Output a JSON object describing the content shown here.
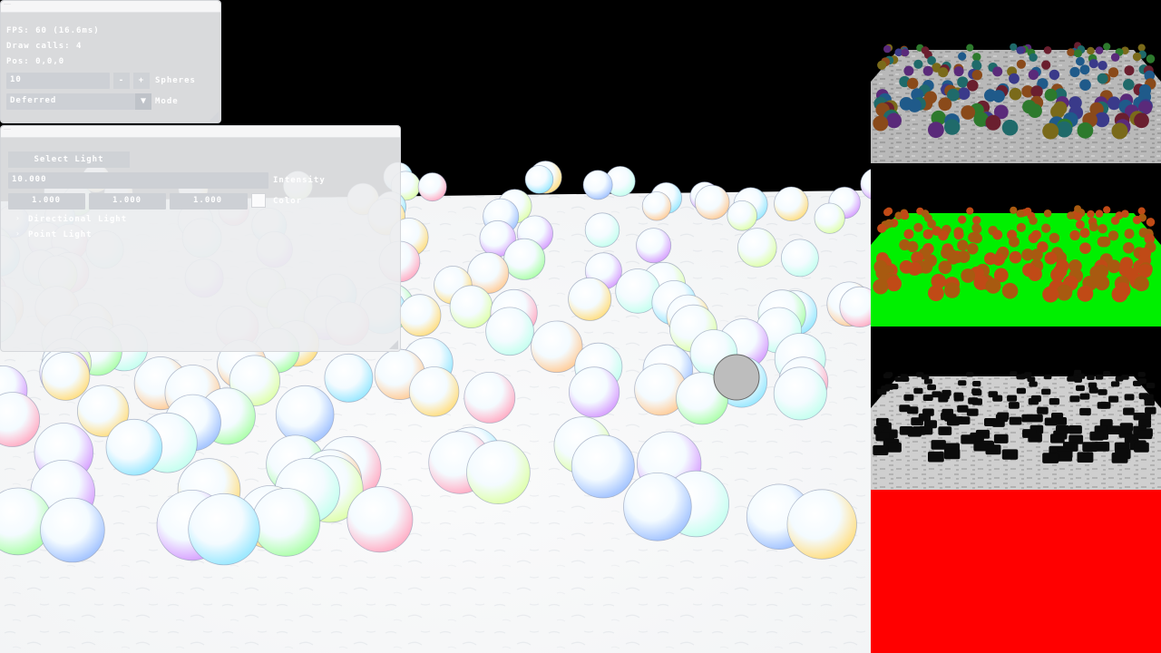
{
  "stats_panel": {
    "line1": "FPS: 60 (16.6ms)",
    "line2": "Draw calls: 4",
    "line3": "Pos: 0,0,0",
    "spin_value": "10",
    "minus_label": "-",
    "plus_label": "+",
    "spin_label": "Spheres",
    "combo_value": "Deferred",
    "combo_arrow": "▼",
    "combo_label": "Mode"
  },
  "light_panel": {
    "header_button": "Select Light",
    "intensity_value": "10.000",
    "intensity_label": "Intensity",
    "color_r": "1.000",
    "color_g": "1.000",
    "color_b": "1.000",
    "color_label": "Color",
    "tree_items": [
      "Directional Light",
      "Point Light"
    ],
    "tree_arrow": "›"
  },
  "colors": {
    "panel_bg": "#eceeef",
    "field_bg": "#cdd0d5",
    "normal_buffer_floor": "#00ff00",
    "bottom_buffer": "#ff0000",
    "viewport_floor": "#f4f5f6"
  },
  "icons": {
    "minus": "minus-icon",
    "plus": "plus-icon",
    "combo": "chevron-down-icon",
    "tree": "chevron-right-icon"
  }
}
